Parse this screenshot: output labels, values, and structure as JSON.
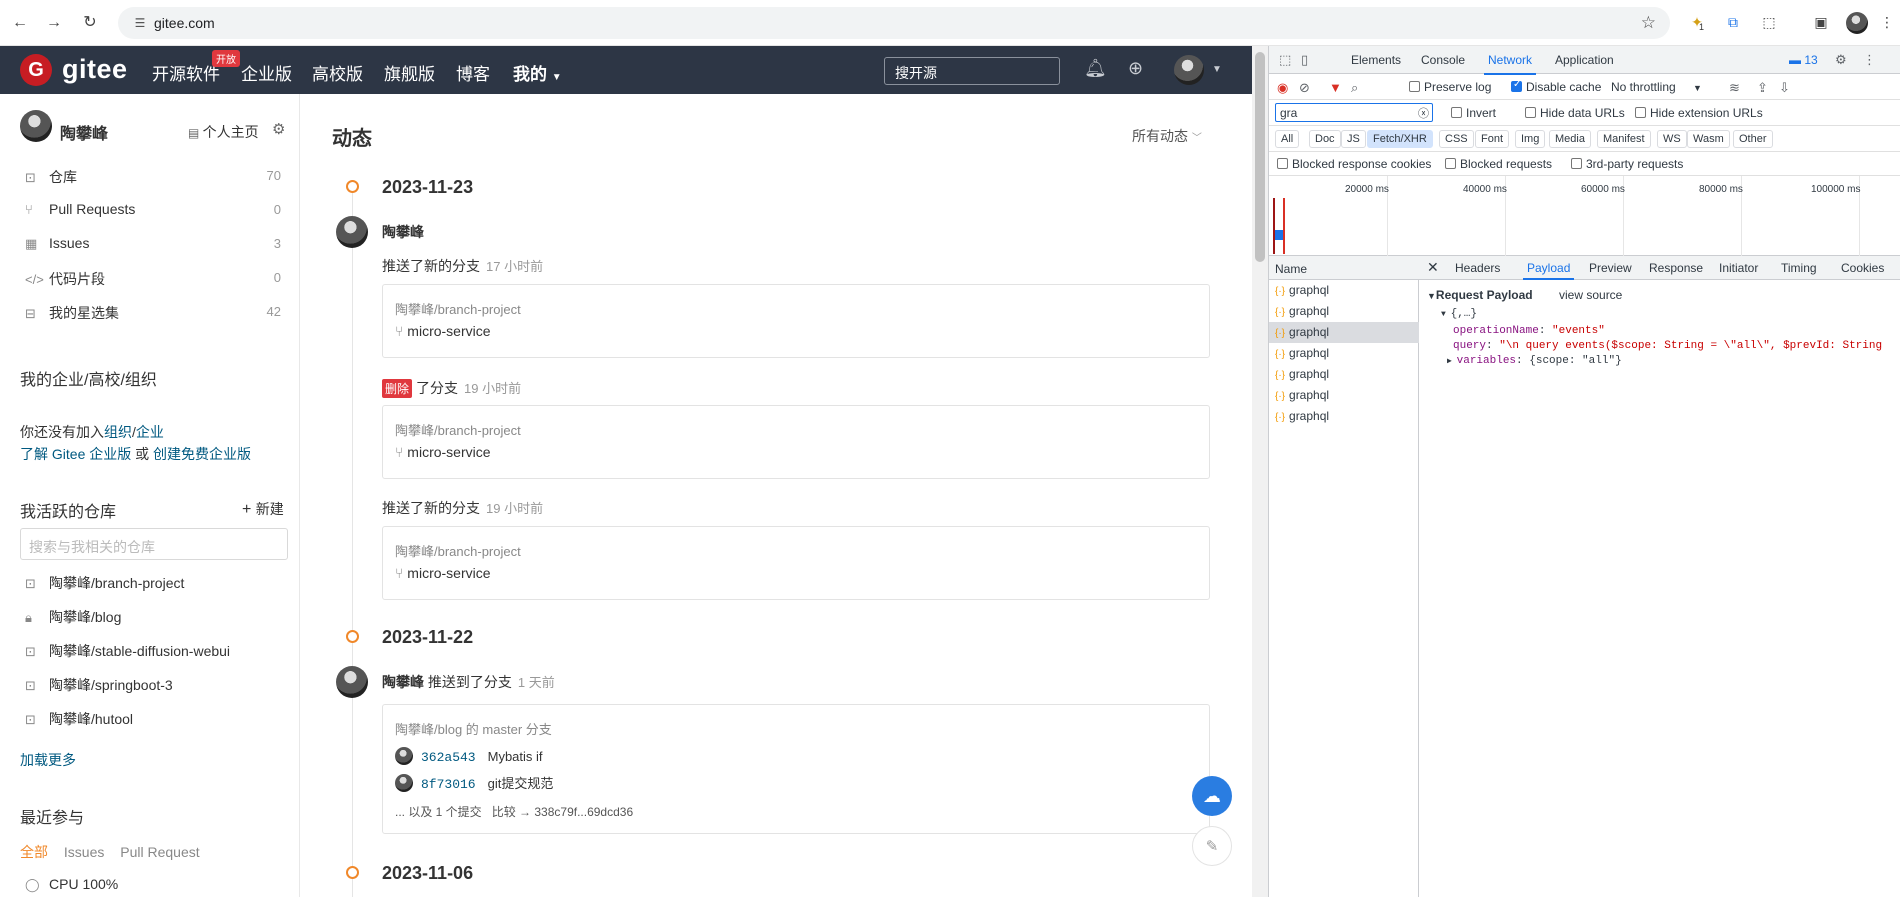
{
  "browser": {
    "url": "gitee.com",
    "ext_badge": "1"
  },
  "gitee": {
    "logo_mark": "G",
    "logo": "gitee",
    "nav": [
      "开源软件",
      "企业版",
      "高校版",
      "旗舰版",
      "博客",
      "我的"
    ],
    "nav_badge": "开放",
    "search_placeholder": "搜开源",
    "sidebar": {
      "user_name": "陶攀峰",
      "home_link": "个人主页",
      "items": [
        {
          "label": "仓库",
          "count": "70"
        },
        {
          "label": "Pull Requests",
          "count": "0"
        },
        {
          "label": "Issues",
          "count": "3"
        },
        {
          "label": "代码片段",
          "count": "0"
        },
        {
          "label": "我的星选集",
          "count": "42"
        }
      ],
      "org_heading": "我的企业/高校/组织",
      "org_text_1": "你还没有加入",
      "org_link_1": "组织",
      "org_sep": "/",
      "org_link_2": "企业",
      "org_text_2": "了解 Gitee 企业版",
      "org_or": " 或 ",
      "org_link_3": "创建免费企业版",
      "repo_heading": "我活跃的仓库",
      "new_label": "新建",
      "repo_search_placeholder": "搜索与我相关的仓库",
      "repos": [
        "陶攀峰/branch-project",
        "陶攀峰/blog",
        "陶攀峰/stable-diffusion-webui",
        "陶攀峰/springboot-3",
        "陶攀峰/hutool"
      ],
      "load_more": "加载更多",
      "recent_heading": "最近参与",
      "recent_tabs": [
        "全部",
        "Issues",
        "Pull Request"
      ],
      "recent_item": "CPU 100%"
    },
    "feed": {
      "title": "动态",
      "filter": "所有动态",
      "dates": [
        "2023-11-23",
        "2023-11-22",
        "2023-11-06"
      ],
      "user": "陶攀峰",
      "ev1_text": "推送了新的分支",
      "ev1_time": "17 小时前",
      "repo1": "陶攀峰/branch-project",
      "branch": "micro-service",
      "del_badge": "删除",
      "ev2_text": "了分支",
      "ev2_time": "19 小时前",
      "ev3_text": "推送了新的分支",
      "ev3_time": "19 小时前",
      "ev4_text": "推送到了分支",
      "ev4_time": "1 天前",
      "repo2": "陶攀峰/blog 的 master 分支",
      "commits": [
        {
          "sha": "362a543",
          "msg": "Mybatis if"
        },
        {
          "sha": "8f73016",
          "msg": "git提交规范"
        }
      ],
      "more_commits": "... 以及 1 个提交",
      "compare": "比较 → 338c79f...69dcd36"
    }
  },
  "devtools": {
    "tabs": [
      "Elements",
      "Console",
      "Network",
      "Application"
    ],
    "issues_count": "13",
    "toolbar": {
      "preserve_log": "Preserve log",
      "disable_cache": "Disable cache",
      "throttle": "No throttling"
    },
    "filter": {
      "value": "gra",
      "invert": "Invert",
      "hide_data": "Hide data URLs",
      "hide_ext": "Hide extension URLs"
    },
    "types": [
      "All",
      "Doc",
      "JS",
      "Fetch/XHR",
      "CSS",
      "Font",
      "Img",
      "Media",
      "Manifest",
      "WS",
      "Wasm",
      "Other"
    ],
    "blocked": [
      "Blocked response cookies",
      "Blocked requests",
      "3rd-party requests"
    ],
    "timeline_labels": [
      "20000 ms",
      "40000 ms",
      "60000 ms",
      "80000 ms",
      "100000 ms"
    ],
    "name_header": "Name",
    "requests": [
      "graphql",
      "graphql",
      "graphql",
      "graphql",
      "graphql",
      "graphql",
      "graphql"
    ],
    "detail_tabs": [
      "Headers",
      "Payload",
      "Preview",
      "Response",
      "Initiator",
      "Timing",
      "Cookies"
    ],
    "payload": {
      "section": "Request Payload",
      "view_source": "view source",
      "root": "{,…}",
      "op_key": "operationName",
      "op_val": "\"events\"",
      "query_key": "query",
      "query_val": "\"\\n    query events($scope: String = \\\"all\\\", $prevId: String",
      "vars_key": "variables",
      "vars_val": "{scope: \"all\"}"
    }
  }
}
